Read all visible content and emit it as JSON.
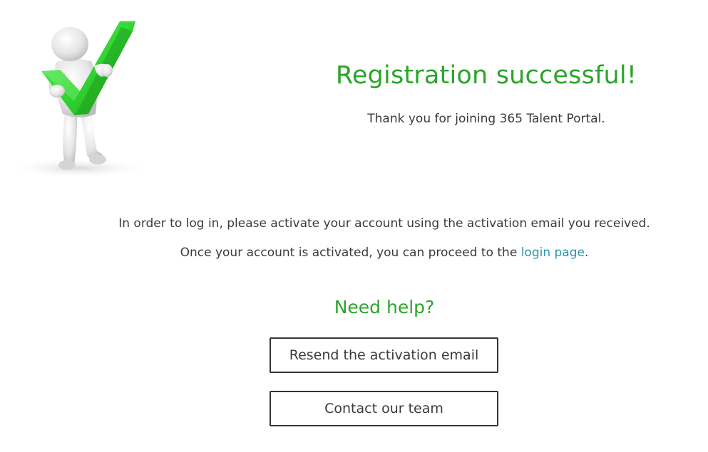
{
  "hero": {
    "illustration": "person-holding-green-checkmark",
    "check_color": "#2fd12f"
  },
  "title": "Registration successful!",
  "thanks": "Thank you for joining 365 Talent Portal.",
  "instructions": {
    "line1": "In order to log in, please activate your account using the activation email you received.",
    "line2_prefix": "Once your account is activated, you can proceed to the ",
    "login_link": "login page",
    "line2_suffix": "."
  },
  "help": {
    "title": "Need help?",
    "resend_label": "Resend the activation email",
    "contact_label": "Contact our team"
  },
  "colors": {
    "accent_green": "#2aa52a",
    "link_blue": "#2e92b5",
    "text": "#3a3a3a"
  }
}
